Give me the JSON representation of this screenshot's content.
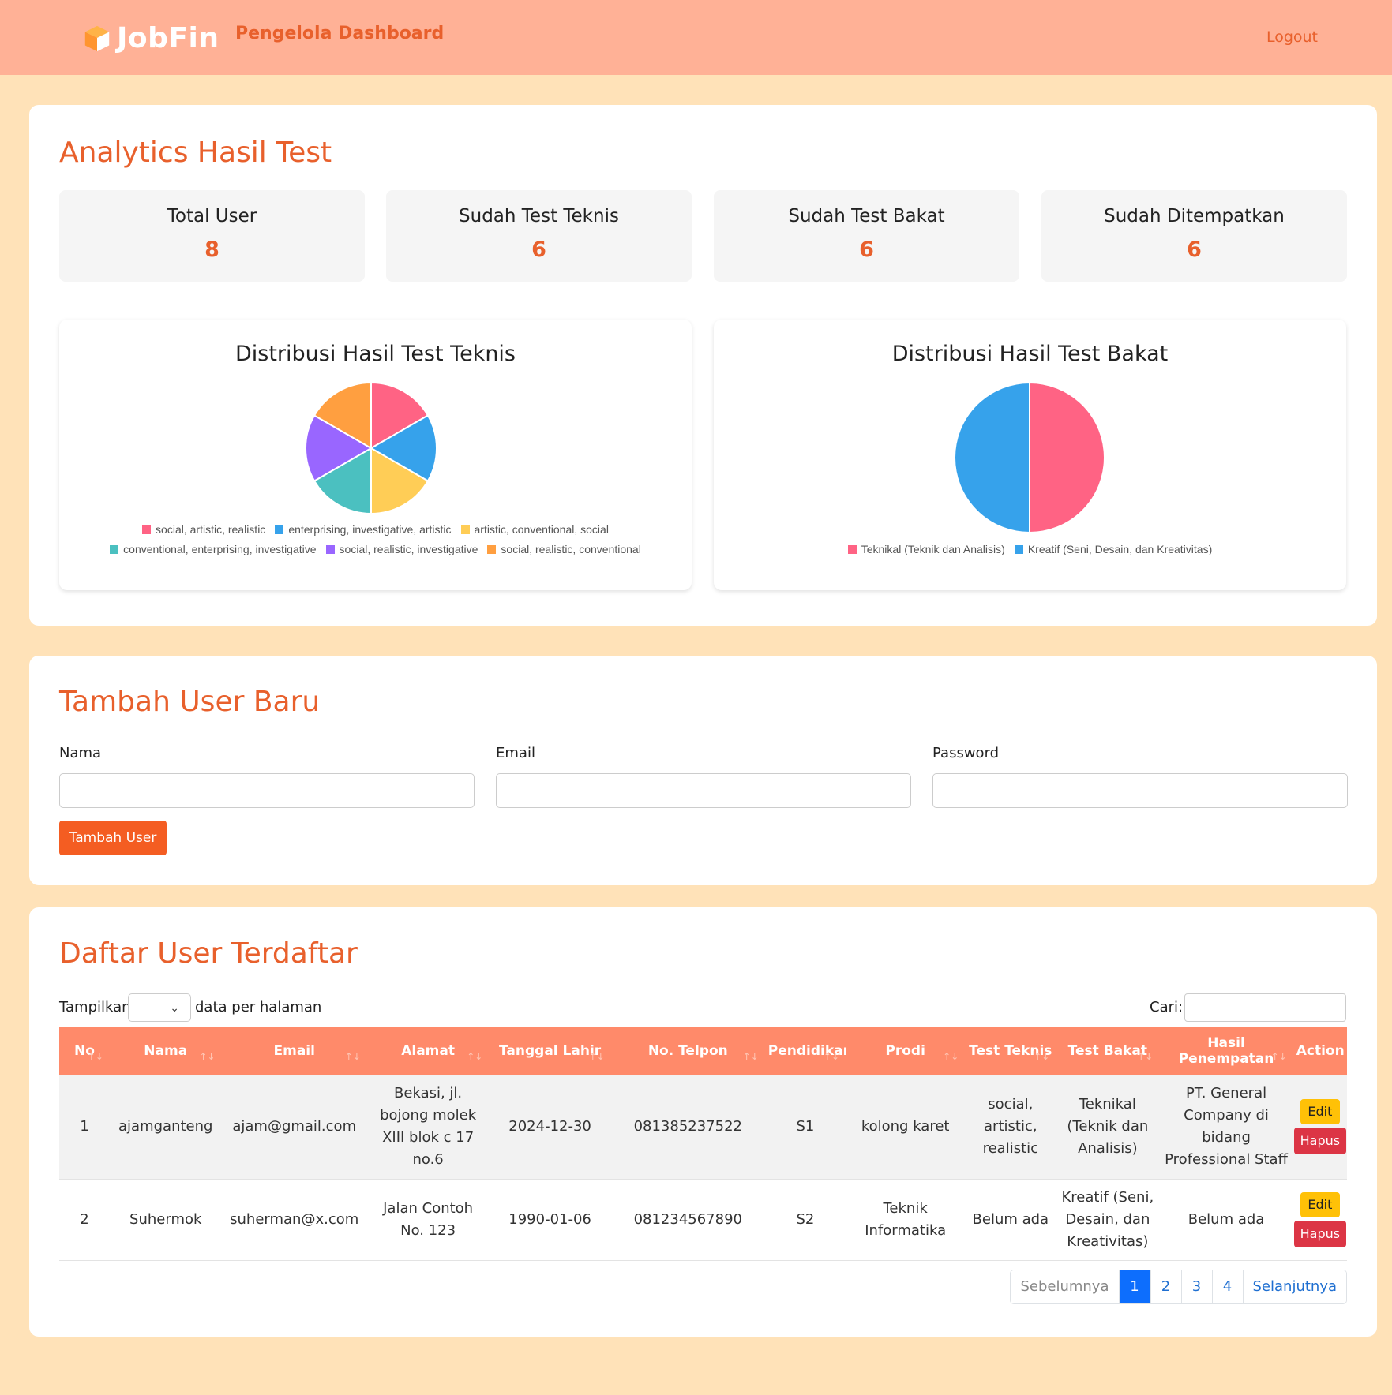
{
  "header": {
    "brand": "JobFin",
    "title": "Pengelola Dashboard",
    "logout": "Logout"
  },
  "analytics": {
    "title": "Analytics Hasil Test",
    "stats": [
      {
        "label": "Total User",
        "value": "8"
      },
      {
        "label": "Sudah Test Teknis",
        "value": "6"
      },
      {
        "label": "Sudah Test Bakat",
        "value": "6"
      },
      {
        "label": "Sudah Ditempatkan",
        "value": "6"
      }
    ]
  },
  "chart_data": [
    {
      "type": "pie",
      "title": "Distribusi Hasil Test Teknis",
      "categories": [
        "social, artistic, realistic",
        "enterprising, investigative, artistic",
        "artistic, conventional, social",
        "conventional, enterprising, investigative",
        "social, realistic, investigative",
        "social, realistic, conventional"
      ],
      "values": [
        1,
        1,
        1,
        1,
        1,
        1
      ],
      "colors": [
        "#ff6384",
        "#36a2eb",
        "#ffcd56",
        "#4bc0c0",
        "#9966ff",
        "#ff9f40"
      ],
      "legend": "bottom"
    },
    {
      "type": "pie",
      "title": "Distribusi Hasil Test Bakat",
      "categories": [
        "Teknikal (Teknik dan Analisis)",
        "Kreatif (Seni, Desain, dan Kreativitas)"
      ],
      "values": [
        1,
        1
      ],
      "colors": [
        "#ff6384",
        "#36a2eb"
      ],
      "legend": "bottom"
    }
  ],
  "add_user": {
    "title": "Tambah User Baru",
    "fields": [
      {
        "label": "Nama",
        "value": ""
      },
      {
        "label": "Email",
        "value": ""
      },
      {
        "label": "Password",
        "value": ""
      }
    ],
    "submit": "Tambah User"
  },
  "users": {
    "title": "Daftar User Terdaftar",
    "length_prefix": "Tampilkan",
    "length_suffix": "data per halaman",
    "search_label": "Cari:",
    "columns": [
      "No",
      "Nama",
      "Email",
      "Alamat",
      "Tanggal Lahir",
      "No. Telpon",
      "Pendidikan",
      "Prodi",
      "Test Teknis",
      "Test Bakat",
      "Hasil Penempatan",
      "Action"
    ],
    "rows": [
      [
        "1",
        "ajamganteng",
        "ajam@gmail.com",
        "Bekasi, jl. bojong molek XIII blok c 17 no.6",
        "2024-12-30",
        "081385237522",
        "S1",
        "kolong karet",
        "social, artistic, realistic",
        "Teknikal (Teknik dan Analisis)",
        "PT. General Company di bidang Professional Staff"
      ],
      [
        "2",
        "Suhermok",
        "suherman@x.com",
        "Jalan Contoh No. 123",
        "1990-01-06",
        "081234567890",
        "S2",
        "Teknik Informatika",
        "Belum ada",
        "Kreatif (Seni, Desain, dan Kreativitas)",
        "Belum ada"
      ]
    ],
    "actions": {
      "edit": "Edit",
      "delete": "Hapus"
    },
    "pagination": {
      "previous": "Sebelumnya",
      "pages": [
        "1",
        "2",
        "3",
        "4"
      ],
      "active": "1",
      "next": "Selanjutnya"
    }
  }
}
